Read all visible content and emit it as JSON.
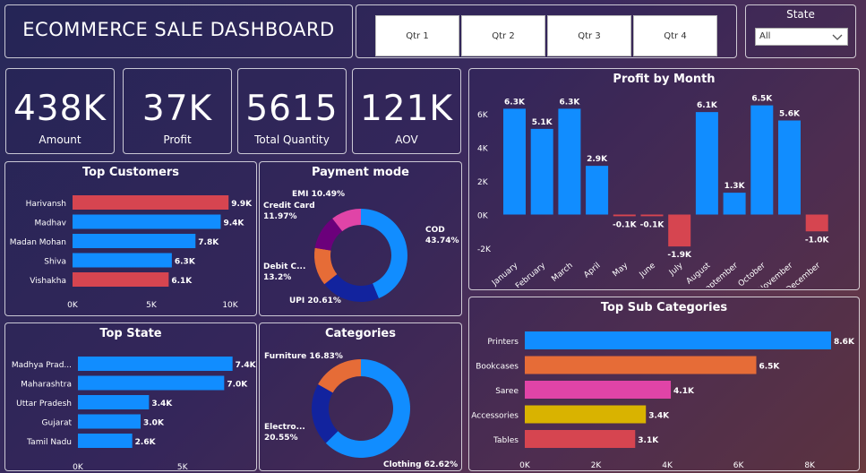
{
  "header": {
    "title": "ECOMMERCE SALE DASHBOARD"
  },
  "quarters": [
    "Qtr 1",
    "Qtr 2",
    "Qtr 3",
    "Qtr 4"
  ],
  "state_filter": {
    "label": "State",
    "value": "All"
  },
  "kpis": [
    {
      "value": "438K",
      "label": "Amount"
    },
    {
      "value": "37K",
      "label": "Profit"
    },
    {
      "value": "5615",
      "label": "Total Quantity"
    },
    {
      "value": "121K",
      "label": "AOV"
    }
  ],
  "colors": {
    "blue": "#118dff",
    "red": "#d64550",
    "navy": "#12239e",
    "orange": "#e66c37",
    "purple": "#6b007b",
    "pink": "#e044a7",
    "gold": "#d9b300"
  },
  "chart_data": [
    {
      "id": "profit_month",
      "type": "bar",
      "title": "Profit by Month",
      "categories": [
        "January",
        "February",
        "March",
        "April",
        "May",
        "June",
        "July",
        "August",
        "September",
        "October",
        "November",
        "December"
      ],
      "values": [
        6.3,
        5.1,
        6.3,
        2.9,
        -0.1,
        -0.1,
        -1.9,
        6.1,
        1.3,
        6.5,
        5.6,
        -1.0
      ],
      "labels": [
        "6.3K",
        "5.1K",
        "6.3K",
        "2.9K",
        "-0.1K",
        "-0.1K",
        "-1.9K",
        "6.1K",
        "1.3K",
        "6.5K",
        "5.6K",
        "-1.0K"
      ],
      "yticks": [
        "6K",
        "4K",
        "2K",
        "0K",
        "-2K"
      ],
      "ylim": [
        -2,
        6
      ],
      "unit": "K"
    },
    {
      "id": "top_customers",
      "type": "bar",
      "orientation": "horizontal",
      "title": "Top Customers",
      "categories": [
        "Harivansh",
        "Madhav",
        "Madan Mohan",
        "Shiva",
        "Vishakha"
      ],
      "values": [
        9.9,
        9.4,
        7.8,
        6.3,
        6.1
      ],
      "labels": [
        "9.9K",
        "9.4K",
        "7.8K",
        "6.3K",
        "6.1K"
      ],
      "colors": [
        "red",
        "blue",
        "blue",
        "blue",
        "red"
      ],
      "xticks": [
        "0K",
        "5K",
        "10K"
      ],
      "xlim": [
        0,
        10
      ]
    },
    {
      "id": "payment_mode",
      "type": "pie",
      "title": "Payment mode",
      "slices": [
        {
          "name": "COD",
          "value": 43.74,
          "label": "COD",
          "pct": "43.74%",
          "color": "blue"
        },
        {
          "name": "UPI",
          "value": 20.61,
          "label": "UPI",
          "pct": "20.61%",
          "color": "navy"
        },
        {
          "name": "Debit Card",
          "value": 13.2,
          "label": "Debit C...",
          "pct": "13.2%",
          "color": "orange"
        },
        {
          "name": "Credit Card",
          "value": 11.97,
          "label": "Credit Card",
          "pct": "11.97%",
          "color": "purple"
        },
        {
          "name": "EMI",
          "value": 10.49,
          "label": "EMI",
          "pct": "10.49%",
          "color": "pink"
        }
      ]
    },
    {
      "id": "top_state",
      "type": "bar",
      "orientation": "horizontal",
      "title": "Top State",
      "categories": [
        "Madhya Prad...",
        "Maharashtra",
        "Uttar Pradesh",
        "Gujarat",
        "Tamil Nadu"
      ],
      "values": [
        7.4,
        7.0,
        3.4,
        3.0,
        2.6
      ],
      "labels": [
        "7.4K",
        "7.0K",
        "3.4K",
        "3.0K",
        "2.6K"
      ],
      "colors": [
        "blue",
        "blue",
        "blue",
        "blue",
        "blue"
      ],
      "xticks": [
        "0K",
        "5K"
      ],
      "xlim": [
        0,
        7.5
      ]
    },
    {
      "id": "categories",
      "type": "pie",
      "title": "Categories",
      "slices": [
        {
          "name": "Clothing",
          "value": 62.62,
          "label": "Clothing",
          "pct": "62.62%",
          "color": "blue"
        },
        {
          "name": "Electronics",
          "value": 20.55,
          "label": "Electro...",
          "pct": "20.55%",
          "color": "navy"
        },
        {
          "name": "Furniture",
          "value": 16.83,
          "label": "Furniture",
          "pct": "16.83%",
          "color": "orange"
        }
      ]
    },
    {
      "id": "sub_categories",
      "type": "bar",
      "orientation": "horizontal",
      "title": "Top Sub Categories",
      "categories": [
        "Printers",
        "Bookcases",
        "Saree",
        "Accessories",
        "Tables"
      ],
      "values": [
        8.6,
        6.5,
        4.1,
        3.4,
        3.1
      ],
      "labels": [
        "8.6K",
        "6.5K",
        "4.1K",
        "3.4K",
        "3.1K"
      ],
      "colors": [
        "blue",
        "orange",
        "pink",
        "gold",
        "red"
      ],
      "xticks": [
        "0K",
        "2K",
        "4K",
        "6K",
        "8K"
      ],
      "xlim": [
        0,
        8.6
      ]
    }
  ]
}
